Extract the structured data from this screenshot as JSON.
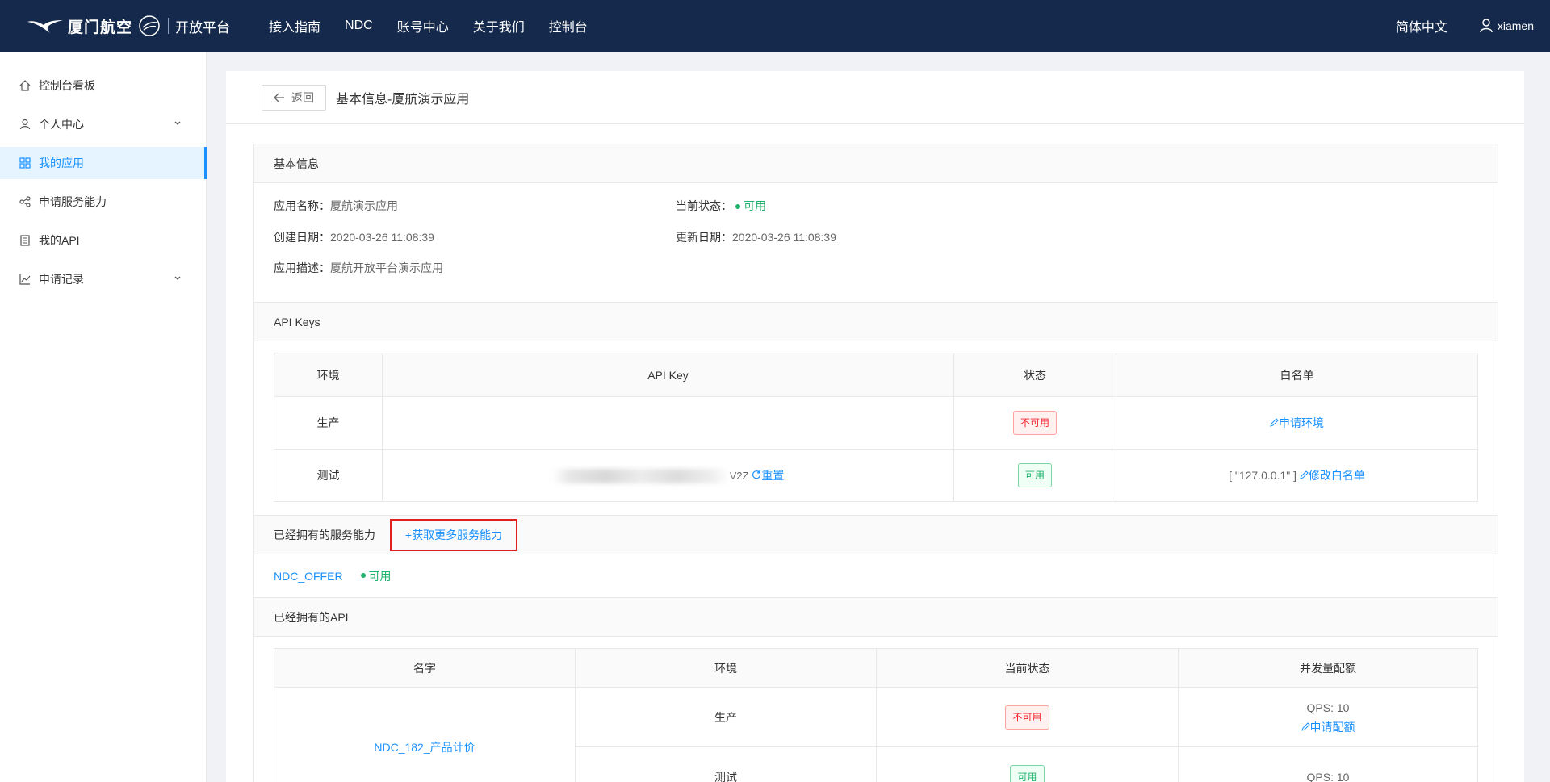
{
  "topbar": {
    "logo_text": "厦门航空",
    "platform": "开放平台",
    "nav": [
      "接入指南",
      "NDC",
      "账号中心",
      "关于我们",
      "控制台"
    ],
    "language": "简体中文",
    "username": "xiamen"
  },
  "sidebar": {
    "items": [
      {
        "label": "控制台看板",
        "icon": "home-icon"
      },
      {
        "label": "个人中心",
        "icon": "user-icon"
      },
      {
        "label": "我的应用",
        "icon": "apps-icon"
      },
      {
        "label": "申请服务能力",
        "icon": "share-icon"
      },
      {
        "label": "我的API",
        "icon": "doc-icon"
      },
      {
        "label": "申请记录",
        "icon": "chart-icon"
      }
    ]
  },
  "header": {
    "back_label": "返回",
    "title": "基本信息-厦航演示应用"
  },
  "basic_info": {
    "section_title": "基本信息",
    "app_name_label": "应用名称：",
    "app_name": "厦航演示应用",
    "status_label": "当前状态：",
    "status": "可用",
    "created_label": "创建日期：",
    "created": "2020-03-26 11:08:39",
    "updated_label": "更新日期：",
    "updated": "2020-03-26 11:08:39",
    "desc_label": "应用描述：",
    "desc": "厦航开放平台演示应用"
  },
  "api_keys": {
    "section_title": "API Keys",
    "columns": [
      "环境",
      "API Key",
      "状态",
      "白名单"
    ],
    "rows": [
      {
        "env": "生产",
        "key_suffix": "",
        "reset": "",
        "status": "不可用",
        "whitelist": "",
        "action": "申请环境"
      },
      {
        "env": "测试",
        "key_suffix": "V2Z",
        "reset": "重置",
        "status": "可用",
        "whitelist": "[ \"127.0.0.1\" ]",
        "action": "修改白名单"
      }
    ]
  },
  "services": {
    "section_title": "已经拥有的服务能力",
    "more_button": "+获取更多服务能力",
    "items": [
      {
        "name": "NDC_OFFER",
        "status": "可用"
      }
    ]
  },
  "apis": {
    "section_title": "已经拥有的API",
    "columns": [
      "名字",
      "环境",
      "当前状态",
      "并发量配额"
    ],
    "name": "NDC_182_产品计价",
    "rows": [
      {
        "env": "生产",
        "status": "不可用",
        "quota": "QPS: 10",
        "action": "申请配额"
      },
      {
        "env": "测试",
        "status": "可用",
        "quota": "QPS: 10"
      }
    ]
  },
  "colors": {
    "topbar": "#14294b",
    "accent": "#1890ff",
    "ok": "#1fb26b",
    "bad": "#f5222d",
    "highlight": "#e0201f"
  }
}
